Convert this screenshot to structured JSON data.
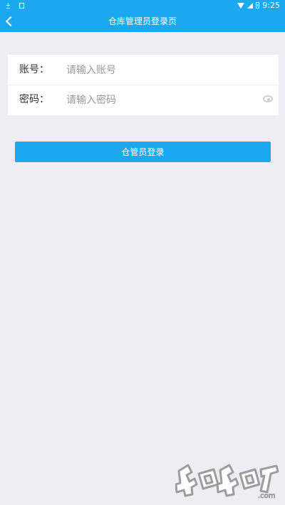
{
  "status": {
    "time": "9:25"
  },
  "header": {
    "title": "仓库管理员登录页"
  },
  "form": {
    "account_label": "账号：",
    "account_placeholder": "请输入账号",
    "password_label": "密码：",
    "password_placeholder": "请输入密码"
  },
  "button": {
    "login_label": "仓管员登录"
  },
  "watermark": {
    "text": "4o4o7.com"
  },
  "colors": {
    "primary": "#1aa9f0",
    "background": "#eeedf3",
    "card": "#ffffff",
    "placeholder": "#999999"
  }
}
